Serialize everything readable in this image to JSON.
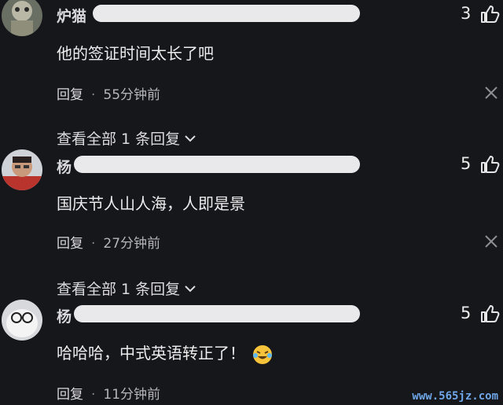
{
  "comments": [
    {
      "username": "炉猫",
      "likes": "3",
      "text": "他的签证时间太长了吧",
      "reply_label": "回复",
      "time": "55分钟前",
      "view_more": "查看全部 1 条回复"
    },
    {
      "username": "杨",
      "likes": "5",
      "text": "国庆节人山人海，人即是景",
      "reply_label": "回复",
      "time": "27分钟前",
      "view_more": "查看全部 1 条回复"
    },
    {
      "username": "杨",
      "likes": "5",
      "text": "哈哈哈，中式英语转正了！",
      "reply_label": "回复",
      "time": "11分钟前"
    }
  ],
  "separator": "·",
  "icons": {
    "like": "thumbs-up-icon",
    "close": "close-icon",
    "expand": "chevron-down-icon",
    "emoji": "laughing-tears-emoji"
  },
  "watermark": "www.565jz.com"
}
